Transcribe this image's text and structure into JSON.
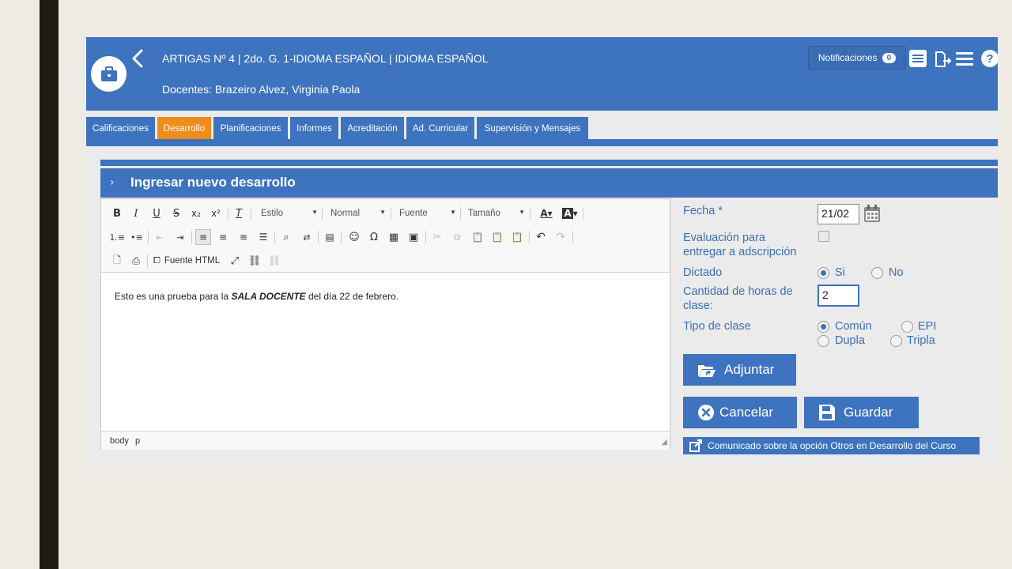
{
  "header": {
    "title": "ARTIGAS Nº 4 | 2do. G. 1-IDIOMA ESPAÑOL | IDIOMA ESPAÑOL",
    "subtitle": "Docentes: Brazeiro Alvez, Virginia Paola",
    "notifications_label": "Notificaciones",
    "notifications_count": "0",
    "icons": [
      "list-icon",
      "export-icon",
      "menu-icon",
      "help-icon"
    ]
  },
  "tabs": [
    {
      "label": "Calificaciones",
      "active": false
    },
    {
      "label": "Desarrollo",
      "active": true
    },
    {
      "label": "Planificaciones",
      "active": false
    },
    {
      "label": "Informes",
      "active": false
    },
    {
      "label": "Acreditación",
      "active": false
    },
    {
      "label": "Ad. Curricular",
      "active": false
    },
    {
      "label": "Supervisión y Mensajes",
      "active": false
    }
  ],
  "panel": {
    "title": "Ingresar nuevo desarrollo"
  },
  "editor": {
    "style_combo": "Estilo",
    "format_combo": "Normal",
    "font_combo": "Fuente",
    "size_combo": "Tamaño",
    "source_label": "Fuente HTML",
    "content_before": "Esto es una prueba para la ",
    "content_bold": "SALA DOCENTE",
    "content_after": " del día 22 de febrero.",
    "path_body": "body",
    "path_p": "p"
  },
  "form": {
    "fecha_label": "Fecha *",
    "fecha_value": "21/02",
    "evaluacion_label_1": "Evaluación para",
    "evaluacion_label_2": "entregar a adscripción",
    "evaluacion_checked": false,
    "dictado_label": "Dictado",
    "dictado_options": [
      "Si",
      "No"
    ],
    "dictado_selected": "Si",
    "horas_label_1": "Cantidad de horas de",
    "horas_label_2": "clase:",
    "horas_value": "2",
    "tipo_label": "Tipo de clase",
    "tipo_options": [
      "Común",
      "EPI",
      "Dupla",
      "Tripla"
    ],
    "tipo_selected": "Común"
  },
  "buttons": {
    "adjuntar": "Adjuntar",
    "cancelar": "Cancelar",
    "guardar": "Guardar",
    "comunicado": "Comunicado sobre la opción Otros en Desarrollo del Curso"
  },
  "colors": {
    "primary": "#3d73bf",
    "active_tab": "#f08c1a",
    "background": "#eeebe4",
    "panel": "#ebebeb"
  }
}
